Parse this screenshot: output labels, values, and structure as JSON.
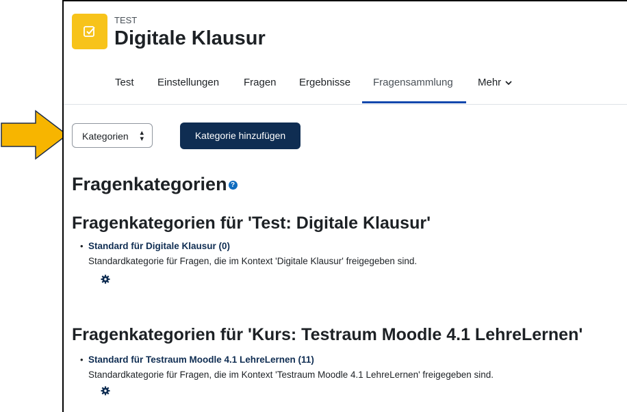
{
  "header": {
    "pretitle": "TEST",
    "title": "Digitale Klausur",
    "icon": "quiz-checkbox-icon",
    "icon_color": "#f7c31a"
  },
  "tabs": [
    {
      "label": "Test"
    },
    {
      "label": "Einstellungen"
    },
    {
      "label": "Fragen"
    },
    {
      "label": "Ergebnisse"
    },
    {
      "label": "Fragensammlung",
      "active": true
    },
    {
      "label": "Mehr"
    }
  ],
  "toolbar": {
    "select_value": "Kategorien",
    "add_button_label": "Kategorie hinzufügen"
  },
  "page_title": "Fragenkategorien",
  "sections": [
    {
      "heading": "Fragenkategorien für 'Test: Digitale Klausur'",
      "category_link": "Standard für Digitale Klausur (0)",
      "category_desc": "Standardkategorie für Fragen, die im Kontext 'Digitale Klausur' freigegeben sind."
    },
    {
      "heading": "Fragenkategorien für 'Kurs: Testraum Moodle 4.1 LehreLernen'",
      "category_link": "Standard für Testraum Moodle 4.1 LehreLernen (11)",
      "category_desc": "Standardkategorie für Fragen, die im Kontext 'Testraum Moodle 4.1 LehreLernen' freigegeben sind."
    }
  ],
  "colors": {
    "accent": "#0f47ad",
    "button": "#0f2d52",
    "arrow": "#f7b500"
  }
}
